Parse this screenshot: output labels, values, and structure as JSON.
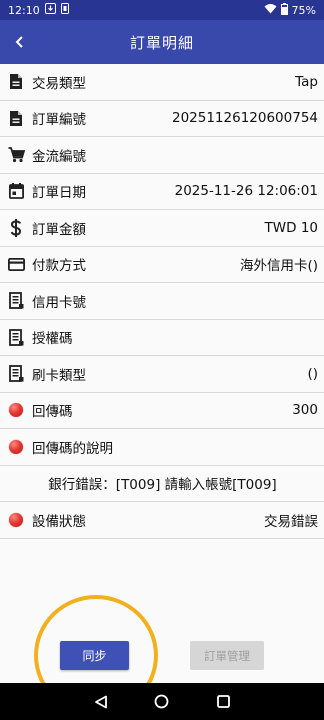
{
  "status_bar": {
    "time": "12:10",
    "battery": "75%"
  },
  "app_bar": {
    "title": "訂單明細"
  },
  "rows": [
    {
      "icon": "document-icon",
      "label": "交易類型",
      "value": "Tap"
    },
    {
      "icon": "document-icon",
      "label": "訂單編號",
      "value": "20251126120600754"
    },
    {
      "icon": "cart-icon",
      "label": "金流編號",
      "value": ""
    },
    {
      "icon": "calendar-icon",
      "label": "訂單日期",
      "value": "2025-11-26 12:06:01"
    },
    {
      "icon": "dollar-icon",
      "label": "訂單金額",
      "value": "TWD 10"
    },
    {
      "icon": "credit-card-icon",
      "label": "付款方式",
      "value": "海外信用卡()"
    },
    {
      "icon": "receipt-icon",
      "label": "信用卡號",
      "value": ""
    },
    {
      "icon": "receipt-icon",
      "label": "授權碼",
      "value": ""
    },
    {
      "icon": "receipt-icon",
      "label": "刷卡類型",
      "value": "()"
    },
    {
      "icon": "red-dot-icon",
      "label": "回傳碼",
      "value": "300"
    },
    {
      "icon": "red-dot-icon",
      "label": "回傳碼的說明",
      "value": ""
    },
    {
      "icon": "none",
      "label": "",
      "value": "銀行錯誤：[T009] 請輸入帳號[T009]"
    },
    {
      "icon": "red-dot-icon",
      "label": "設備狀態",
      "value": "交易錯誤"
    }
  ],
  "buttons": {
    "sync": "同步",
    "order_management": "訂單管理"
  },
  "colors": {
    "status_bar": "#283593",
    "app_bar": "#3948ab",
    "primary_button": "#3f51b5",
    "disabled_button": "#d6d6d6",
    "highlight_circle": "#f2b01e"
  }
}
